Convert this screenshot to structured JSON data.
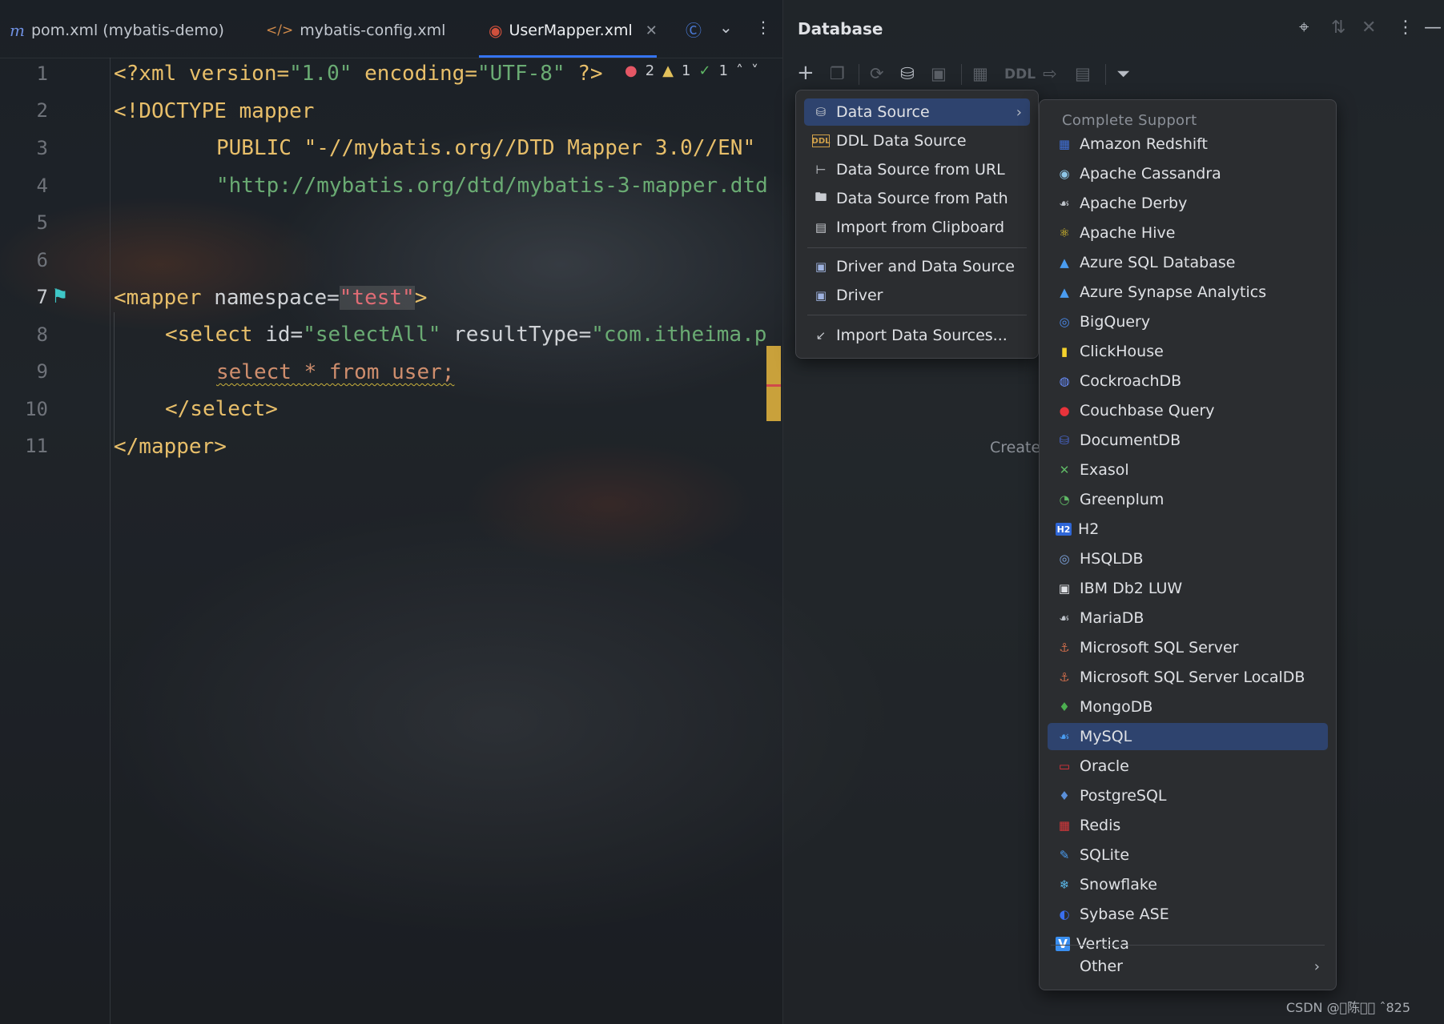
{
  "editor": {
    "tabs": [
      {
        "label": "pom.xml (mybatis-demo)",
        "icon": "maven-icon"
      },
      {
        "label": "mybatis-config.xml",
        "icon": "xml-icon"
      },
      {
        "label": "UserMapper.xml",
        "icon": "mybatis-icon",
        "active": true
      }
    ],
    "inspections": {
      "errors": "2",
      "warnings": "1",
      "typos": "1"
    },
    "line_numbers": [
      "1",
      "2",
      "3",
      "4",
      "5",
      "6",
      "7",
      "8",
      "9",
      "10",
      "11"
    ],
    "code": {
      "l1_a": "<?xml version=",
      "l1_b": "\"1.0\"",
      "l1_c": " encoding=",
      "l1_d": "\"UTF-8\"",
      "l1_e": " ?>",
      "l2": "<!DOCTYPE mapper",
      "l3": "PUBLIC \"-//mybatis.org//DTD Mapper 3.0//EN\"",
      "l4": "\"http://mybatis.org/dtd/mybatis-3-mapper.dtd",
      "l7_a": "<mapper",
      "l7_b": " namespace=",
      "l7_c": "\"test\"",
      "l7_d": ">",
      "l8_a": "<select",
      "l8_b": " id=",
      "l8_c": "\"selectAll\"",
      "l8_d": " resultType=",
      "l8_e": "\"com.itheima.p",
      "l9": "select * from user;",
      "l10": "</select>",
      "l11": "</mapper>"
    },
    "create_hint": "Create"
  },
  "database": {
    "title": "Database",
    "toolbar_ddl": "DDL",
    "menu": [
      {
        "label": "Data Source",
        "icon": "database-icon",
        "submenu": true,
        "selected": true
      },
      {
        "label": "DDL Data Source",
        "icon": "ddl-icon"
      },
      {
        "label": "Data Source from URL",
        "icon": "url-plug-icon"
      },
      {
        "label": "Data Source from Path",
        "icon": "folder-icon"
      },
      {
        "label": "Import from Clipboard",
        "icon": "clipboard-icon"
      },
      {
        "label": "Driver and Data Source",
        "icon": "driver-icon"
      },
      {
        "label": "Driver",
        "icon": "driver-icon"
      },
      {
        "label": "Import Data Sources...",
        "icon": "import-icon"
      }
    ],
    "submenu": {
      "header": "Complete Support",
      "items": [
        {
          "label": "Amazon Redshift",
          "color": "#3f6fd8"
        },
        {
          "label": "Apache Cassandra",
          "color": "#8fc7e8"
        },
        {
          "label": "Apache Derby",
          "color": "#bfc4cb"
        },
        {
          "label": "Apache Hive",
          "color": "#f1d12b"
        },
        {
          "label": "Azure SQL Database",
          "color": "#4a9cf0"
        },
        {
          "label": "Azure Synapse Analytics",
          "color": "#4a9cf0"
        },
        {
          "label": "BigQuery",
          "color": "#4a8cf0"
        },
        {
          "label": "ClickHouse",
          "color": "#f5d22c"
        },
        {
          "label": "CockroachDB",
          "color": "#6a8fff"
        },
        {
          "label": "Couchbase Query",
          "color": "#e8333b"
        },
        {
          "label": "DocumentDB",
          "color": "#4a6ad8"
        },
        {
          "label": "Exasol",
          "color": "#5fb865"
        },
        {
          "label": "Greenplum",
          "color": "#5fb865"
        },
        {
          "label": "H2",
          "color": "#2f66d6"
        },
        {
          "label": "HSQLDB",
          "color": "#7fa6e0"
        },
        {
          "label": "IBM Db2 LUW",
          "color": "#dfe1e5"
        },
        {
          "label": "MariaDB",
          "color": "#bfc4cb"
        },
        {
          "label": "Microsoft SQL Server",
          "color": "#c76a4a"
        },
        {
          "label": "Microsoft SQL Server LocalDB",
          "color": "#c76a4a"
        },
        {
          "label": "MongoDB",
          "color": "#4caf50"
        },
        {
          "label": "MySQL",
          "color": "#4a9cf0",
          "selected": true
        },
        {
          "label": "Oracle",
          "color": "#e8333b"
        },
        {
          "label": "PostgreSQL",
          "color": "#5a8fd8"
        },
        {
          "label": "Redis",
          "color": "#d8383b"
        },
        {
          "label": "SQLite",
          "color": "#4a9cf0"
        },
        {
          "label": "Snowflake",
          "color": "#5ab7e8"
        },
        {
          "label": "Sybase ASE",
          "color": "#3a6ff0"
        },
        {
          "label": "Vertica",
          "color": "#3a8ff0"
        }
      ],
      "other": "Other"
    }
  },
  "watermark": "CSDN @\u0000陈\u0000\u0000 ˆ825",
  "colors": {
    "selection": "#2e436e",
    "accent": "#3574f0"
  }
}
